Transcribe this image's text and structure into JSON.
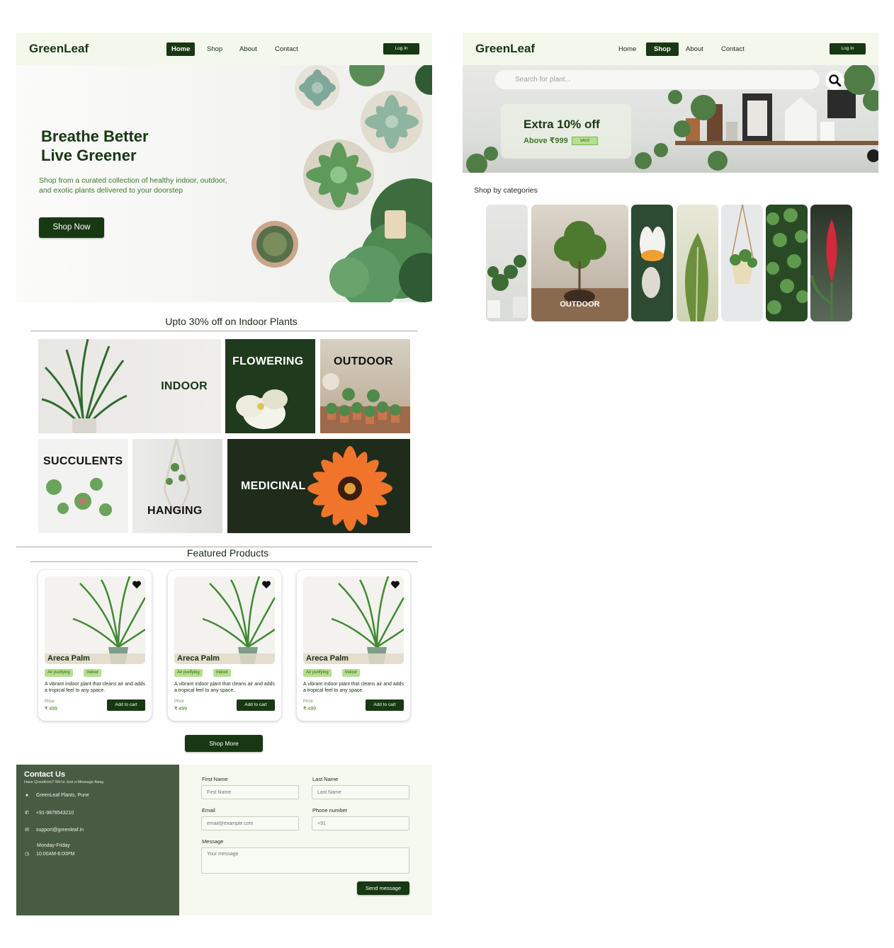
{
  "home": {
    "nav": {
      "logo": "GreenLeaf",
      "links": [
        "Home",
        "Shop",
        "About",
        "Contact"
      ],
      "active": "Home",
      "login": "Log In"
    },
    "hero": {
      "title_line1": "Breathe Better",
      "title_line2": "Live Greener",
      "subtitle": "Shop from a curated collection of healthy indoor, outdoor, and exotic plants delivered to your doorstep",
      "cta": "Shop Now"
    },
    "offer_title": "Upto 30% off on Indoor Plants",
    "categories": [
      "INDOOR",
      "FLOWERING",
      "OUTDOOR",
      "SUCCULENTS",
      "HANGING",
      "MEDICINAL"
    ],
    "featured": {
      "title": "Featured Products",
      "products": [
        {
          "name": "Areca Palm",
          "tags": [
            "Air purifying",
            "Indoor"
          ],
          "desc": "A vibrant indoor plant that cleans air and adds a tropical feel to any space.",
          "price_label": "Price",
          "price": "₹ 499",
          "button": "Add to cart"
        },
        {
          "name": "Areca Palm",
          "tags": [
            "Air purifying",
            "Indoor"
          ],
          "desc": "A vibrant indoor plant that cleans air and adds a tropical feel to any space.",
          "price_label": "Price",
          "price": "₹ 499",
          "button": "Add to cart"
        },
        {
          "name": "Areca Palm",
          "tags": [
            "Air purifying",
            "Indoor"
          ],
          "desc": "A vibrant indoor plant that cleans air and adds a tropical feel to any space.",
          "price_label": "Price",
          "price": "₹ 499",
          "button": "Add to cart"
        }
      ],
      "more": "Shop More"
    },
    "contact": {
      "title": "Contact Us",
      "subtitle": "Have Questions? We're Just a Message Away.",
      "address": "GreenLeaf Plants, Pune",
      "phone": "+91-9876543210",
      "email": "support@greenleaf.in",
      "hours_days": "Monday-Friday",
      "hours_time": "10:00AM-6:00PM",
      "form": {
        "first_name_label": "First Name",
        "first_name_ph": "First Name",
        "last_name_label": "Last Name",
        "last_name_ph": "Last Name",
        "email_label": "Email",
        "email_ph": "email@example.com",
        "phone_label": "Phone  number",
        "phone_ph": "+91",
        "message_label": "Message",
        "message_ph": "Your message",
        "submit": "Send message"
      }
    }
  },
  "shop": {
    "nav": {
      "logo": "GreenLeaf",
      "links": [
        "Home",
        "Shop",
        "About",
        "Contact"
      ],
      "active": "Shop",
      "login": "Log In"
    },
    "search_placeholder": "Search for plant...",
    "promo": {
      "title": "Extra 10% off",
      "sub": "Above ₹999",
      "code": "SAVI2"
    },
    "categories_title": "Shop by categories",
    "featured_category": "OUTDOOR"
  },
  "colors": {
    "brand_dark": "#173812",
    "brand_green": "#3b7a26",
    "chip": "#b5e08f",
    "nav_bg": "#f3f7ec",
    "contact_panel": "#4a5b43"
  }
}
